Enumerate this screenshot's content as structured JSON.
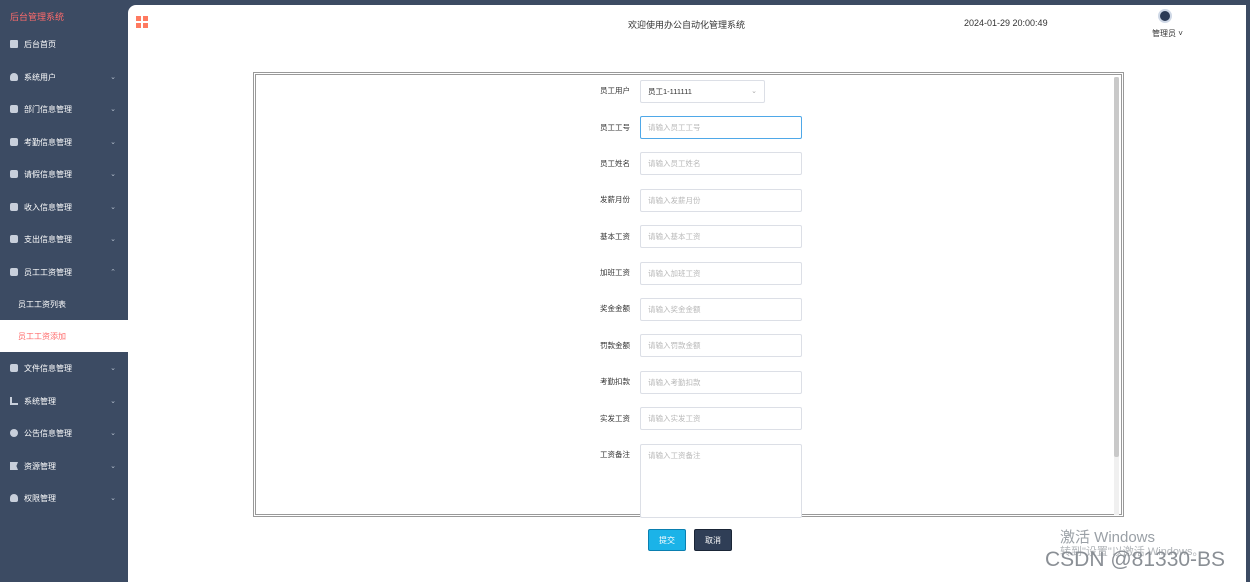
{
  "sidebar": {
    "title": "后台管理系统",
    "items": [
      {
        "label": "后台首页",
        "icon": "home-icon"
      },
      {
        "label": "系统用户",
        "icon": "user-icon"
      },
      {
        "label": "部门信息管理",
        "icon": "box-icon"
      },
      {
        "label": "考勤信息管理",
        "icon": "box-icon"
      },
      {
        "label": "请假信息管理",
        "icon": "box-icon"
      },
      {
        "label": "收入信息管理",
        "icon": "box-icon"
      },
      {
        "label": "支出信息管理",
        "icon": "box-icon"
      },
      {
        "label": "员工工资管理",
        "icon": "box-icon"
      },
      {
        "label": "文件信息管理",
        "icon": "box-icon"
      },
      {
        "label": "系统管理",
        "icon": "bar-chart-icon"
      },
      {
        "label": "公告信息管理",
        "icon": "info-icon"
      },
      {
        "label": "资源管理",
        "icon": "flag-icon"
      },
      {
        "label": "权限管理",
        "icon": "user-icon"
      }
    ],
    "submenu": {
      "list": "员工工资列表",
      "add": "员工工资添加"
    }
  },
  "header": {
    "welcome": "欢迎使用办公自动化管理系统",
    "datetime": "2024-01-29 20:00:49",
    "user": "管理员"
  },
  "form": {
    "fields": [
      {
        "label": "员工用户",
        "value": "员工1-111111"
      },
      {
        "label": "员工工号",
        "placeholder": "请输入员工工号"
      },
      {
        "label": "员工姓名",
        "placeholder": "请输入员工姓名"
      },
      {
        "label": "发薪月份",
        "placeholder": "请输入发薪月份"
      },
      {
        "label": "基本工资",
        "placeholder": "请输入基本工资"
      },
      {
        "label": "加班工资",
        "placeholder": "请输入加班工资"
      },
      {
        "label": "奖金金额",
        "placeholder": "请输入奖金金额"
      },
      {
        "label": "罚款金额",
        "placeholder": "请输入罚款金额"
      },
      {
        "label": "考勤扣款",
        "placeholder": "请输入考勤扣款"
      },
      {
        "label": "实发工资",
        "placeholder": "请输入实发工资"
      },
      {
        "label": "工资备注",
        "placeholder": "请输入工资备注"
      }
    ],
    "submit": "提交",
    "cancel": "取消"
  },
  "watermark": {
    "line1": "激活 Windows",
    "line2": "转到\"设置\"以激活 Windows。",
    "line3": "CSDN @81330-BS"
  },
  "colors": {
    "sidebar_bg": "#3c4b63",
    "accent": "#ff6b6b",
    "submit_btn": "#1bb3e8",
    "cancel_btn": "#2f3e56"
  }
}
